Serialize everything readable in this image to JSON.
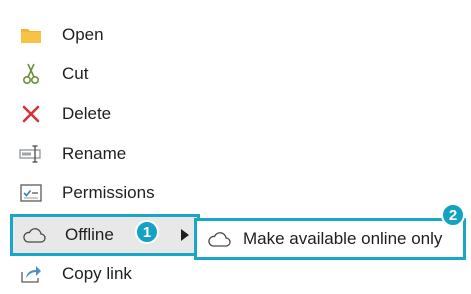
{
  "context_menu": {
    "items": [
      {
        "label": "Open",
        "icon": "folder-icon"
      },
      {
        "label": "Cut",
        "icon": "scissors-icon"
      },
      {
        "label": "Delete",
        "icon": "delete-x-icon"
      },
      {
        "label": "Rename",
        "icon": "rename-icon"
      },
      {
        "label": "Permissions",
        "icon": "permissions-icon"
      },
      {
        "label": "Offline",
        "icon": "cloud-icon",
        "has_submenu": true,
        "highlighted": true
      },
      {
        "label": "Copy link",
        "icon": "share-link-icon"
      }
    ]
  },
  "submenu": {
    "items": [
      {
        "label": "Make available online only",
        "icon": "cloud-icon"
      }
    ]
  },
  "callouts": {
    "badge_1": "1",
    "badge_2": "2"
  },
  "colors": {
    "highlight_border": "#1aa7c7",
    "badge_fill": "#14a2c4",
    "delete_red": "#d13438",
    "folder_yellow": "#f2b632"
  }
}
